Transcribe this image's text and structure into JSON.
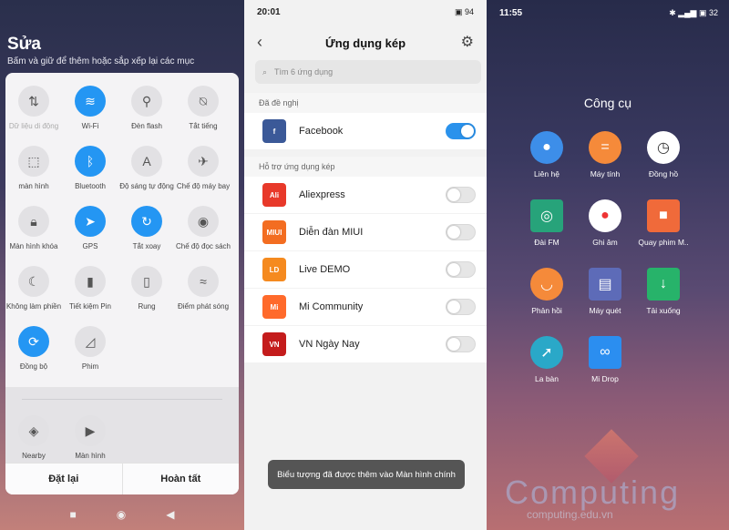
{
  "panel1": {
    "title": "Sửa",
    "subtitle": "Bấm và giữ để thêm hoặc sắp xếp lại các mục",
    "tiles": [
      {
        "label": "Dữ liệu di động",
        "icon": "mobile-data-icon",
        "on": false,
        "dim": true
      },
      {
        "label": "Wi-Fi",
        "icon": "wifi-icon",
        "on": true
      },
      {
        "label": "Đèn flash",
        "icon": "flashlight-icon",
        "on": false
      },
      {
        "label": "Tắt tiếng",
        "icon": "mute-bell-icon",
        "on": false
      },
      {
        "label": "màn hình",
        "icon": "screenshot-icon",
        "on": false
      },
      {
        "label": "Bluetooth",
        "icon": "bluetooth-icon",
        "on": true
      },
      {
        "label": "Độ sáng tự động",
        "icon": "auto-brightness-icon",
        "on": false
      },
      {
        "label": "Chế độ máy bay",
        "icon": "airplane-icon",
        "on": false
      },
      {
        "label": "Màn hình khóa",
        "icon": "lock-icon",
        "on": false
      },
      {
        "label": "GPS",
        "icon": "gps-icon",
        "on": true
      },
      {
        "label": "Tắt xoay",
        "icon": "rotation-lock-icon",
        "on": true
      },
      {
        "label": "Chế độ đọc sách",
        "icon": "eye-icon",
        "on": false
      },
      {
        "label": "Không làm phiền",
        "icon": "moon-icon",
        "on": false
      },
      {
        "label": "Tiết kiệm Pin",
        "icon": "battery-icon",
        "on": false
      },
      {
        "label": "Rung",
        "icon": "vibrate-icon",
        "on": false
      },
      {
        "label": "Điểm phát sóng",
        "icon": "hotspot-icon",
        "on": false
      },
      {
        "label": "Đồng bộ",
        "icon": "sync-icon",
        "on": true
      },
      {
        "label": "Phim",
        "icon": "video-icon",
        "on": false
      },
      {
        "label": "Nearby",
        "icon": "nearby-icon",
        "on": false
      },
      {
        "label": "Màn hình",
        "icon": "screen-record-icon",
        "on": false
      }
    ],
    "reset": "Đặt lại",
    "done": "Hoàn tất"
  },
  "panel2": {
    "time": "20:01",
    "battery": "94",
    "title": "Ứng dụng kép",
    "search_placeholder": "Tìm 6 ứng dụng",
    "section_suggested": "Đã đề nghị",
    "section_supported": "Hỗ trợ ứng dụng kép",
    "suggested": [
      {
        "name": "Facebook",
        "on": true,
        "color": "#3b5998",
        "glyph": "f"
      }
    ],
    "supported": [
      {
        "name": "Aliexpress",
        "on": false,
        "color": "#e8392a",
        "glyph": "Ali"
      },
      {
        "name": "Diễn đàn MIUI",
        "on": false,
        "color": "#f36d21",
        "glyph": "MIUI"
      },
      {
        "name": "Live DEMO",
        "on": false,
        "color": "#f58a1f",
        "glyph": "LD"
      },
      {
        "name": "Mi Community",
        "on": false,
        "color": "#ff6a2b",
        "glyph": "Mi"
      },
      {
        "name": "VN Ngày Nay",
        "on": false,
        "color": "#c41c1c",
        "glyph": "VN"
      }
    ],
    "toast": "Biểu tượng đã được thêm vào Màn hình chính"
  },
  "panel3": {
    "time": "11:55",
    "battery": "32",
    "folder": "Công cụ",
    "apps": [
      {
        "label": "Liên hệ",
        "icon": "contacts-icon",
        "color": "#3d8ee9",
        "shape": "circle",
        "glyph": "●"
      },
      {
        "label": "Máy tính",
        "icon": "calculator-icon",
        "color": "#f58a3a",
        "shape": "circle",
        "glyph": "="
      },
      {
        "label": "Đồng hồ",
        "icon": "clock-icon",
        "color": "#ffffff",
        "shape": "circle",
        "glyph": "◷"
      },
      {
        "label": "Đài FM",
        "icon": "radio-icon",
        "color": "#27a37a",
        "shape": "square",
        "glyph": "◎"
      },
      {
        "label": "Ghi âm",
        "icon": "recorder-icon",
        "color": "#ffffff",
        "shape": "circle",
        "glyph": "●"
      },
      {
        "label": "Quay phim M..",
        "icon": "screen-recorder-icon",
        "color": "#f06a3a",
        "shape": "square",
        "glyph": "■"
      },
      {
        "label": "Phản hồi",
        "icon": "feedback-icon",
        "color": "#f58a3a",
        "shape": "circle",
        "glyph": "◡"
      },
      {
        "label": "Máy quét",
        "icon": "scanner-icon",
        "color": "#5d6bb8",
        "shape": "square",
        "glyph": "▤"
      },
      {
        "label": "Tải xuống",
        "icon": "download-icon",
        "color": "#27b36a",
        "shape": "square",
        "glyph": "↓"
      },
      {
        "label": "La bàn",
        "icon": "compass-icon",
        "color": "#2aa8c8",
        "shape": "circle",
        "glyph": "➚"
      },
      {
        "label": "Mi Drop",
        "icon": "mi-drop-icon",
        "color": "#2b8ef0",
        "shape": "square",
        "glyph": "∞"
      }
    ],
    "watermark": "Computing",
    "watermark_url": "computing.edu.vn"
  }
}
